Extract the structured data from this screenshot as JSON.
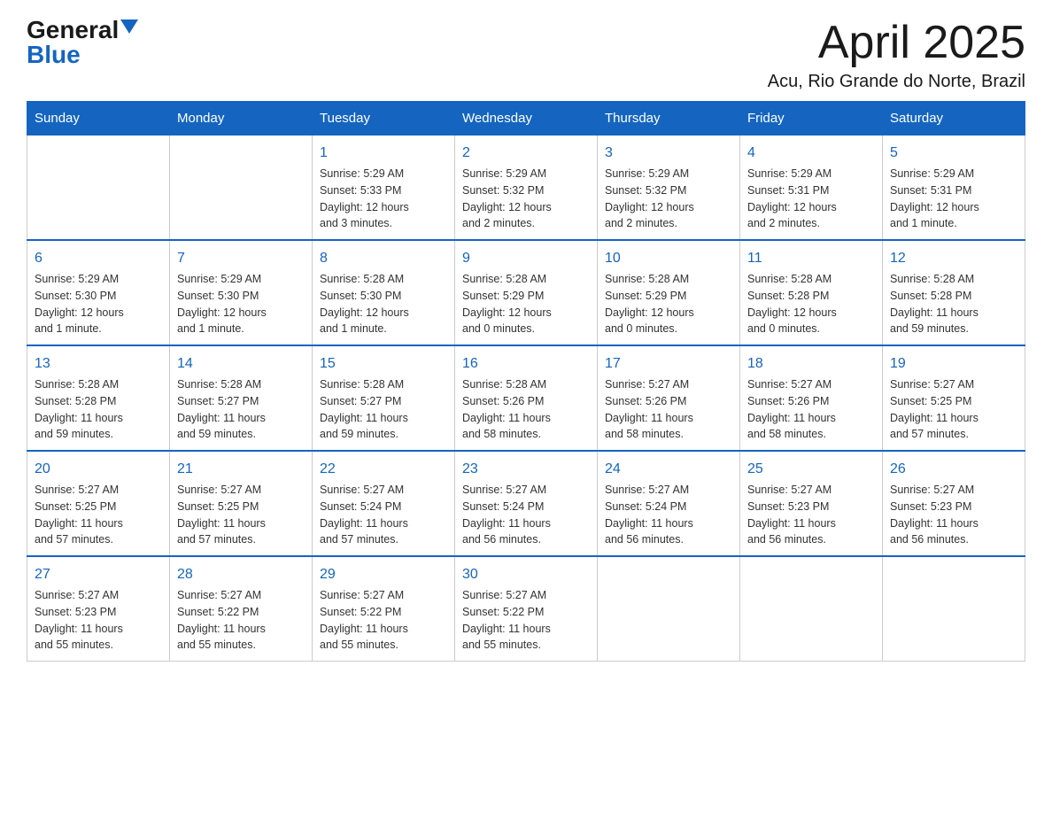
{
  "logo": {
    "general": "General",
    "blue": "Blue"
  },
  "title": "April 2025",
  "location": "Acu, Rio Grande do Norte, Brazil",
  "weekdays": [
    "Sunday",
    "Monday",
    "Tuesday",
    "Wednesday",
    "Thursday",
    "Friday",
    "Saturday"
  ],
  "weeks": [
    [
      {
        "day": "",
        "info": ""
      },
      {
        "day": "",
        "info": ""
      },
      {
        "day": "1",
        "info": "Sunrise: 5:29 AM\nSunset: 5:33 PM\nDaylight: 12 hours\nand 3 minutes."
      },
      {
        "day": "2",
        "info": "Sunrise: 5:29 AM\nSunset: 5:32 PM\nDaylight: 12 hours\nand 2 minutes."
      },
      {
        "day": "3",
        "info": "Sunrise: 5:29 AM\nSunset: 5:32 PM\nDaylight: 12 hours\nand 2 minutes."
      },
      {
        "day": "4",
        "info": "Sunrise: 5:29 AM\nSunset: 5:31 PM\nDaylight: 12 hours\nand 2 minutes."
      },
      {
        "day": "5",
        "info": "Sunrise: 5:29 AM\nSunset: 5:31 PM\nDaylight: 12 hours\nand 1 minute."
      }
    ],
    [
      {
        "day": "6",
        "info": "Sunrise: 5:29 AM\nSunset: 5:30 PM\nDaylight: 12 hours\nand 1 minute."
      },
      {
        "day": "7",
        "info": "Sunrise: 5:29 AM\nSunset: 5:30 PM\nDaylight: 12 hours\nand 1 minute."
      },
      {
        "day": "8",
        "info": "Sunrise: 5:28 AM\nSunset: 5:30 PM\nDaylight: 12 hours\nand 1 minute."
      },
      {
        "day": "9",
        "info": "Sunrise: 5:28 AM\nSunset: 5:29 PM\nDaylight: 12 hours\nand 0 minutes."
      },
      {
        "day": "10",
        "info": "Sunrise: 5:28 AM\nSunset: 5:29 PM\nDaylight: 12 hours\nand 0 minutes."
      },
      {
        "day": "11",
        "info": "Sunrise: 5:28 AM\nSunset: 5:28 PM\nDaylight: 12 hours\nand 0 minutes."
      },
      {
        "day": "12",
        "info": "Sunrise: 5:28 AM\nSunset: 5:28 PM\nDaylight: 11 hours\nand 59 minutes."
      }
    ],
    [
      {
        "day": "13",
        "info": "Sunrise: 5:28 AM\nSunset: 5:28 PM\nDaylight: 11 hours\nand 59 minutes."
      },
      {
        "day": "14",
        "info": "Sunrise: 5:28 AM\nSunset: 5:27 PM\nDaylight: 11 hours\nand 59 minutes."
      },
      {
        "day": "15",
        "info": "Sunrise: 5:28 AM\nSunset: 5:27 PM\nDaylight: 11 hours\nand 59 minutes."
      },
      {
        "day": "16",
        "info": "Sunrise: 5:28 AM\nSunset: 5:26 PM\nDaylight: 11 hours\nand 58 minutes."
      },
      {
        "day": "17",
        "info": "Sunrise: 5:27 AM\nSunset: 5:26 PM\nDaylight: 11 hours\nand 58 minutes."
      },
      {
        "day": "18",
        "info": "Sunrise: 5:27 AM\nSunset: 5:26 PM\nDaylight: 11 hours\nand 58 minutes."
      },
      {
        "day": "19",
        "info": "Sunrise: 5:27 AM\nSunset: 5:25 PM\nDaylight: 11 hours\nand 57 minutes."
      }
    ],
    [
      {
        "day": "20",
        "info": "Sunrise: 5:27 AM\nSunset: 5:25 PM\nDaylight: 11 hours\nand 57 minutes."
      },
      {
        "day": "21",
        "info": "Sunrise: 5:27 AM\nSunset: 5:25 PM\nDaylight: 11 hours\nand 57 minutes."
      },
      {
        "day": "22",
        "info": "Sunrise: 5:27 AM\nSunset: 5:24 PM\nDaylight: 11 hours\nand 57 minutes."
      },
      {
        "day": "23",
        "info": "Sunrise: 5:27 AM\nSunset: 5:24 PM\nDaylight: 11 hours\nand 56 minutes."
      },
      {
        "day": "24",
        "info": "Sunrise: 5:27 AM\nSunset: 5:24 PM\nDaylight: 11 hours\nand 56 minutes."
      },
      {
        "day": "25",
        "info": "Sunrise: 5:27 AM\nSunset: 5:23 PM\nDaylight: 11 hours\nand 56 minutes."
      },
      {
        "day": "26",
        "info": "Sunrise: 5:27 AM\nSunset: 5:23 PM\nDaylight: 11 hours\nand 56 minutes."
      }
    ],
    [
      {
        "day": "27",
        "info": "Sunrise: 5:27 AM\nSunset: 5:23 PM\nDaylight: 11 hours\nand 55 minutes."
      },
      {
        "day": "28",
        "info": "Sunrise: 5:27 AM\nSunset: 5:22 PM\nDaylight: 11 hours\nand 55 minutes."
      },
      {
        "day": "29",
        "info": "Sunrise: 5:27 AM\nSunset: 5:22 PM\nDaylight: 11 hours\nand 55 minutes."
      },
      {
        "day": "30",
        "info": "Sunrise: 5:27 AM\nSunset: 5:22 PM\nDaylight: 11 hours\nand 55 minutes."
      },
      {
        "day": "",
        "info": ""
      },
      {
        "day": "",
        "info": ""
      },
      {
        "day": "",
        "info": ""
      }
    ]
  ]
}
